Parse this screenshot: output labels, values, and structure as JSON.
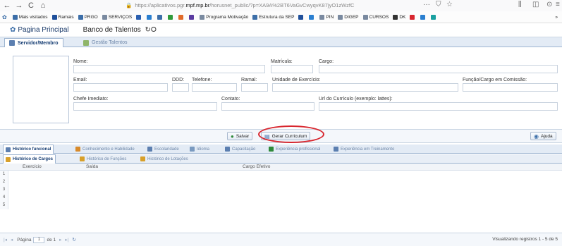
{
  "browser": {
    "back": "←",
    "forward": "→",
    "reload": "C",
    "home": "⌂",
    "url_prefix": "https://aplicativos.pgr.",
    "url_domain": "mpf.mp.br",
    "url_rest": "/horusnet_public/?p=XA9A%2BT6VaGvCwyqvK87jyO1zWzfC",
    "dots": "···",
    "star": "☆",
    "shield": "⛉"
  },
  "bookmarks": [
    {
      "label": "Mais visitados",
      "icon": "gear-icon",
      "color": "#3c6ea8"
    },
    {
      "label": "Ramais",
      "icon": "folder-icon",
      "color": "#1f4f9a"
    },
    {
      "label": "PRGO",
      "icon": "circle-icon",
      "color": "#3c6ea8"
    },
    {
      "label": "SERVIÇOS",
      "icon": "folder-icon",
      "color": "#7a8aa0"
    },
    {
      "label": "",
      "icon": "blue-dot-icon",
      "color": "#2a5fb0"
    },
    {
      "label": "",
      "icon": "blue-dot-icon",
      "color": "#2a7fd0"
    },
    {
      "label": "",
      "icon": "x-icon",
      "color": "#3c6ea8"
    },
    {
      "label": "",
      "icon": "green-icon",
      "color": "#2f9a3a"
    },
    {
      "label": "",
      "icon": "rainbow-icon",
      "color": "#e06a2a"
    },
    {
      "label": "",
      "icon": "flag-icon",
      "color": "#5a3aa0"
    },
    {
      "label": "Programa Motivação",
      "icon": "folder-icon",
      "color": "#7a8aa0"
    },
    {
      "label": "Estrutura da SEP",
      "icon": "circle-icon",
      "color": "#3c6ea8"
    },
    {
      "label": "",
      "icon": "blue-square-icon",
      "color": "#1f4f9a"
    },
    {
      "label": "",
      "icon": "globe-icon",
      "color": "#2a7fd0"
    },
    {
      "label": "PIN",
      "icon": "folder-icon",
      "color": "#7a8aa0"
    },
    {
      "label": "DIGEP",
      "icon": "folder-icon",
      "color": "#7a8aa0"
    },
    {
      "label": "CURSOS",
      "icon": "folder-icon",
      "color": "#7a8aa0"
    },
    {
      "label": "DK",
      "icon": "circle-icon",
      "color": "#333333"
    },
    {
      "label": "",
      "icon": "s-icon",
      "color": "#d8262e"
    },
    {
      "label": "",
      "icon": "arrows-icon",
      "color": "#2a7fd0"
    },
    {
      "label": "",
      "icon": "teal-icon",
      "color": "#1aa0a0"
    }
  ],
  "header": {
    "home_link": "Pagina Principal",
    "title": "Banco de Talentos",
    "title_icons": "↻⭘"
  },
  "tabs_main": [
    {
      "label": "Servidor/Membro",
      "active": true
    },
    {
      "label": "Gestão Talentos",
      "active": false
    }
  ],
  "form": {
    "nome": "Nome:",
    "matricula": "Matrícula:",
    "cargo": "Cargo:",
    "email": "Email:",
    "ddd": "DDD:",
    "telefone": "Telefone:",
    "ramal": "Ramal:",
    "unidade": "Unidade de Exercício:",
    "funcao": "Função/Cargo em Comissão:",
    "chefe": "Chefe Imediato:",
    "contato": "Contato:",
    "url": "Url do Currículo (exemplo: lattes):"
  },
  "actions": {
    "salvar": "Salvar",
    "gerar": "Gerar Curriculum",
    "ajuda": "Ajuda"
  },
  "tabs_history": [
    "Histórico funcional",
    "Conhecimento e Habilidade",
    "Escolaridade",
    "Idioma",
    "Capacitação",
    "Experiência profissional",
    "Experiência em Treinamento"
  ],
  "tabs_sub": [
    "Histórico de Cargos",
    "Histórico de Funções",
    "Histórico de Lotações"
  ],
  "grid": {
    "columns": [
      "Exercício",
      "Saída",
      "Cargo Efetivo"
    ],
    "row_numbers": [
      "1",
      "2",
      "3",
      "4",
      "5"
    ]
  },
  "pager": {
    "page_label": "Página",
    "page_value": "1",
    "of_label": "de 1",
    "status": "Visualizando registros 1 - 5 de 5"
  }
}
